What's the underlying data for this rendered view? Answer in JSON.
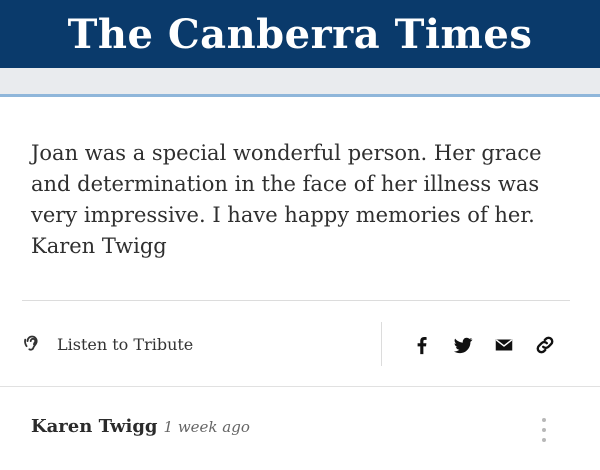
{
  "masthead": {
    "title": "The Canberra Times"
  },
  "tribute": {
    "text": "Joan was a special wonderful person. Her grace and determination in the face of her illness was very impressive. I have happy memories of her. Karen Twigg"
  },
  "actions": {
    "listen_label": "Listen to Tribute",
    "listen_icon": "ear-icon",
    "share_icons": [
      "facebook-icon",
      "twitter-icon",
      "email-icon",
      "link-icon"
    ]
  },
  "comment": {
    "author": "Karen Twigg",
    "time": "1 week ago"
  },
  "colors": {
    "masthead_bg": "#0a3a6b",
    "accent_rule": "#8fb6da",
    "text": "#2b2b2b"
  }
}
